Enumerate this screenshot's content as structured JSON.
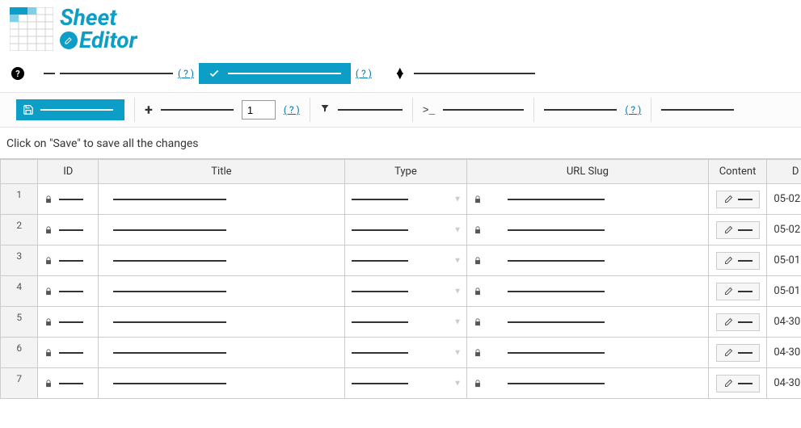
{
  "logo": {
    "line1": "Sheet",
    "line2": "Editor"
  },
  "toolbar1": {
    "help1": "( ? )",
    "help2": "( ? )"
  },
  "toolbar2": {
    "rows_value": "1",
    "help_rows": "( ? )",
    "help_right": "( ? )"
  },
  "hint": "Click on \"Save\" to save all the changes",
  "columns": {
    "rownum": "",
    "id": "ID",
    "title": "Title",
    "type": "Type",
    "slug": "URL Slug",
    "content": "Content",
    "date": "D"
  },
  "rows": [
    {
      "n": "1",
      "date": "05-02"
    },
    {
      "n": "2",
      "date": "05-02"
    },
    {
      "n": "3",
      "date": "05-01"
    },
    {
      "n": "4",
      "date": "05-01"
    },
    {
      "n": "5",
      "date": "04-30"
    },
    {
      "n": "6",
      "date": "04-30"
    },
    {
      "n": "7",
      "date": "04-30"
    }
  ]
}
